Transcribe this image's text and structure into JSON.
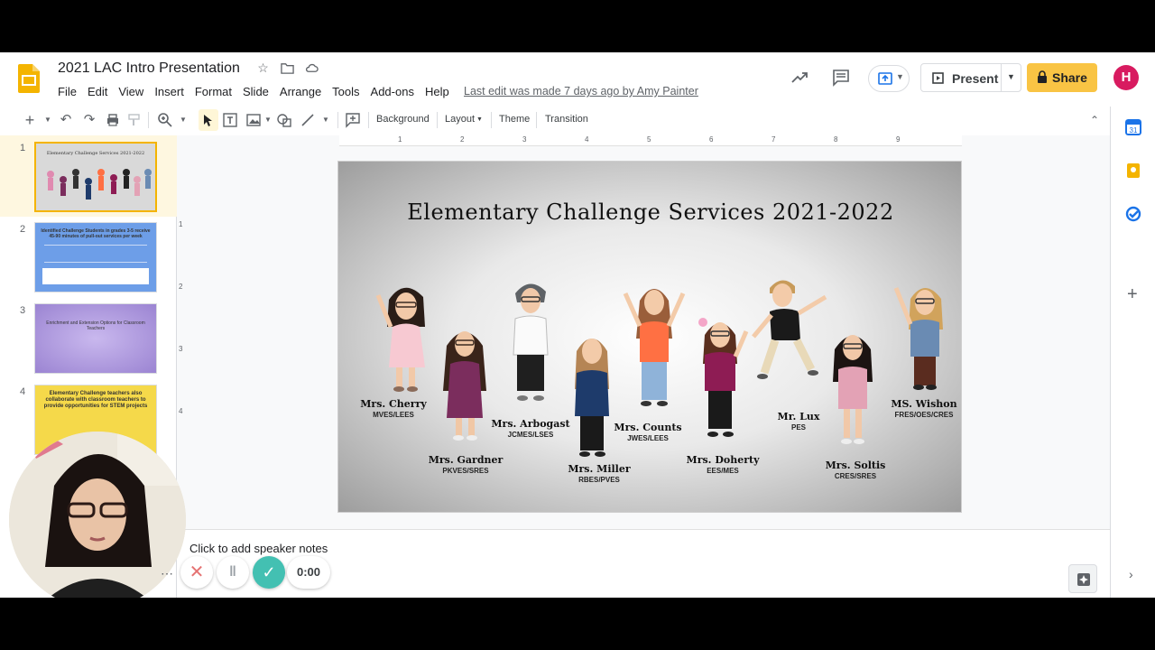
{
  "app": {
    "doc_title": "2021 LAC Intro Presentation",
    "menu": [
      "File",
      "Edit",
      "View",
      "Insert",
      "Format",
      "Slide",
      "Arrange",
      "Tools",
      "Add-ons",
      "Help"
    ],
    "last_edit": "Last edit was made 7 days ago by Amy Painter",
    "present_label": "Present",
    "share_label": "Share",
    "avatar_initial": "H",
    "accent": "#f4b400",
    "share_color": "#f9c444",
    "avatar_color": "#d81b60"
  },
  "toolbar": {
    "background_label": "Background",
    "layout_label": "Layout",
    "theme_label": "Theme",
    "transition_label": "Transition"
  },
  "ruler": [
    "1",
    "2",
    "3",
    "4",
    "5",
    "6",
    "7",
    "8",
    "9"
  ],
  "ruler_v": [
    "1",
    "2",
    "3",
    "4"
  ],
  "filmstrip": [
    {
      "num": "1",
      "text": "Elementary Challenge Services 2021-2022",
      "color": "#d9d9d9"
    },
    {
      "num": "2",
      "text": "Identified Challenge Students in grades 3-5 receive 45-90 minutes of pull-out services per week",
      "color": "#6d9ee8"
    },
    {
      "num": "3",
      "text": "Enrichment and Extension Options for Classroom Teachers",
      "color": "#b7a4e0"
    },
    {
      "num": "4",
      "text": "Elementary Challenge teachers also collaborate with classroom teachers to provide opportunities for STEM projects",
      "color": "#f5d94a"
    }
  ],
  "slide": {
    "title": "Elementary Challenge Services 2021-2022",
    "characters": [
      {
        "name": "Mrs. Cherry",
        "school": "MVES/LEES"
      },
      {
        "name": "Mrs. Gardner",
        "school": "PKVES/SRES"
      },
      {
        "name": "Mrs. Arbogast",
        "school": "JCMES/LSES"
      },
      {
        "name": "Mrs. Miller",
        "school": "RBES/PVES"
      },
      {
        "name": "Mrs. Counts",
        "school": "JWES/LEES"
      },
      {
        "name": "Mrs. Doherty",
        "school": "EES/MES"
      },
      {
        "name": "Mr. Lux",
        "school": "PES"
      },
      {
        "name": "Mrs. Soltis",
        "school": "CRES/SRES"
      },
      {
        "name": "MS. Wishon",
        "school": "FRES/OES/CRES"
      }
    ]
  },
  "notes": {
    "placeholder": "Click to add speaker notes"
  },
  "recorder": {
    "time": "0:00"
  }
}
